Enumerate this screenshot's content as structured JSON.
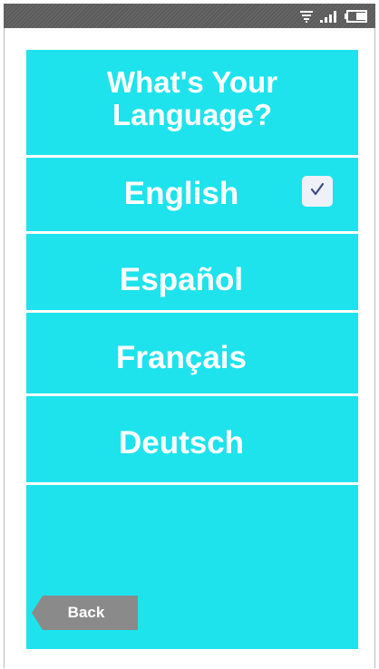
{
  "status_bar": {
    "icons": [
      "wifi-icon",
      "signal-icon",
      "battery-icon"
    ]
  },
  "screen": {
    "title": "What's Your\nLanguage?",
    "background_color": "#1ee3ec"
  },
  "languages": [
    {
      "label": "English",
      "selected": true
    },
    {
      "label": "Español",
      "selected": false
    },
    {
      "label": "Français",
      "selected": false
    },
    {
      "label": "Deutsch",
      "selected": false
    }
  ],
  "back_button": {
    "label": "Back",
    "color": "#8a8a8a"
  }
}
